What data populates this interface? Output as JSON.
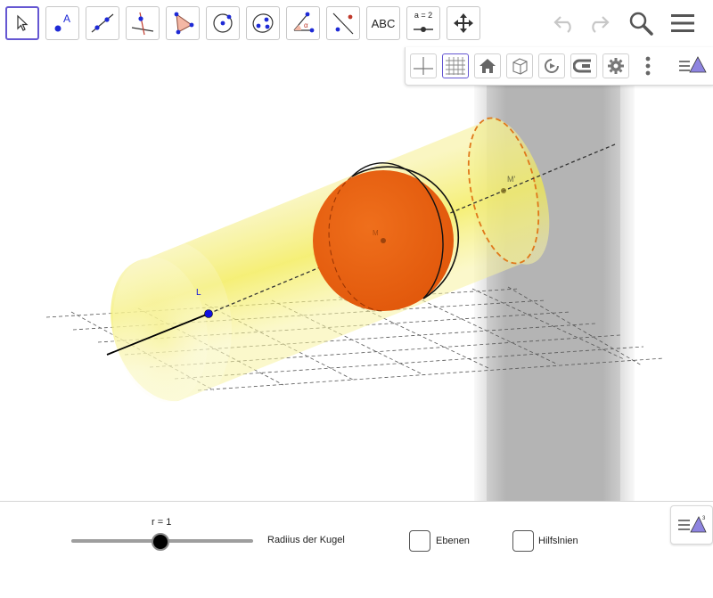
{
  "toolbar": {
    "tools": [
      {
        "id": "move",
        "icon": "cursor-arrow-icon",
        "active": true
      },
      {
        "id": "point",
        "icon": "point-icon",
        "label": "A"
      },
      {
        "id": "line",
        "icon": "line-icon"
      },
      {
        "id": "perpendicular",
        "icon": "perpendicular-line-icon"
      },
      {
        "id": "polygon",
        "icon": "polygon-icon"
      },
      {
        "id": "circle",
        "icon": "circle-icon"
      },
      {
        "id": "sphere",
        "icon": "sphere-points-icon"
      },
      {
        "id": "angle",
        "icon": "angle-icon",
        "label": "α"
      },
      {
        "id": "reflect",
        "icon": "reflect-line-icon"
      },
      {
        "id": "text",
        "icon": "text-icon",
        "label": "ABC"
      },
      {
        "id": "slider",
        "icon": "slider-icon",
        "label": "a = 2"
      },
      {
        "id": "move-view",
        "icon": "move-graphics-view-icon"
      }
    ],
    "right_icons": [
      "undo-icon",
      "redo-icon",
      "search-icon",
      "menu-icon"
    ]
  },
  "graphics_bar": {
    "buttons": [
      "axes-icon",
      "grid-icon",
      "home-icon",
      "view-direction-icon",
      "rotate-view-icon",
      "stereo-glasses-icon",
      "settings-icon",
      "more-vertical-icon",
      "algebra-3d-icon"
    ]
  },
  "scene": {
    "point_labels": {
      "L": "L",
      "M": "M",
      "M_prime": "M'"
    }
  },
  "bottom_panel": {
    "slider": {
      "value_label": "r = 1",
      "value_fraction": 0.49,
      "caption": "Radiius der Kugel"
    },
    "checkboxes": [
      {
        "label": "Ebenen",
        "checked": false
      },
      {
        "label": "Hilfslnien",
        "checked": false
      }
    ]
  },
  "colors": {
    "accent": "#6557d2",
    "sphere": "#e85d0a",
    "cylinder": "#f2ea4a",
    "point_blue": "#1010e0"
  }
}
